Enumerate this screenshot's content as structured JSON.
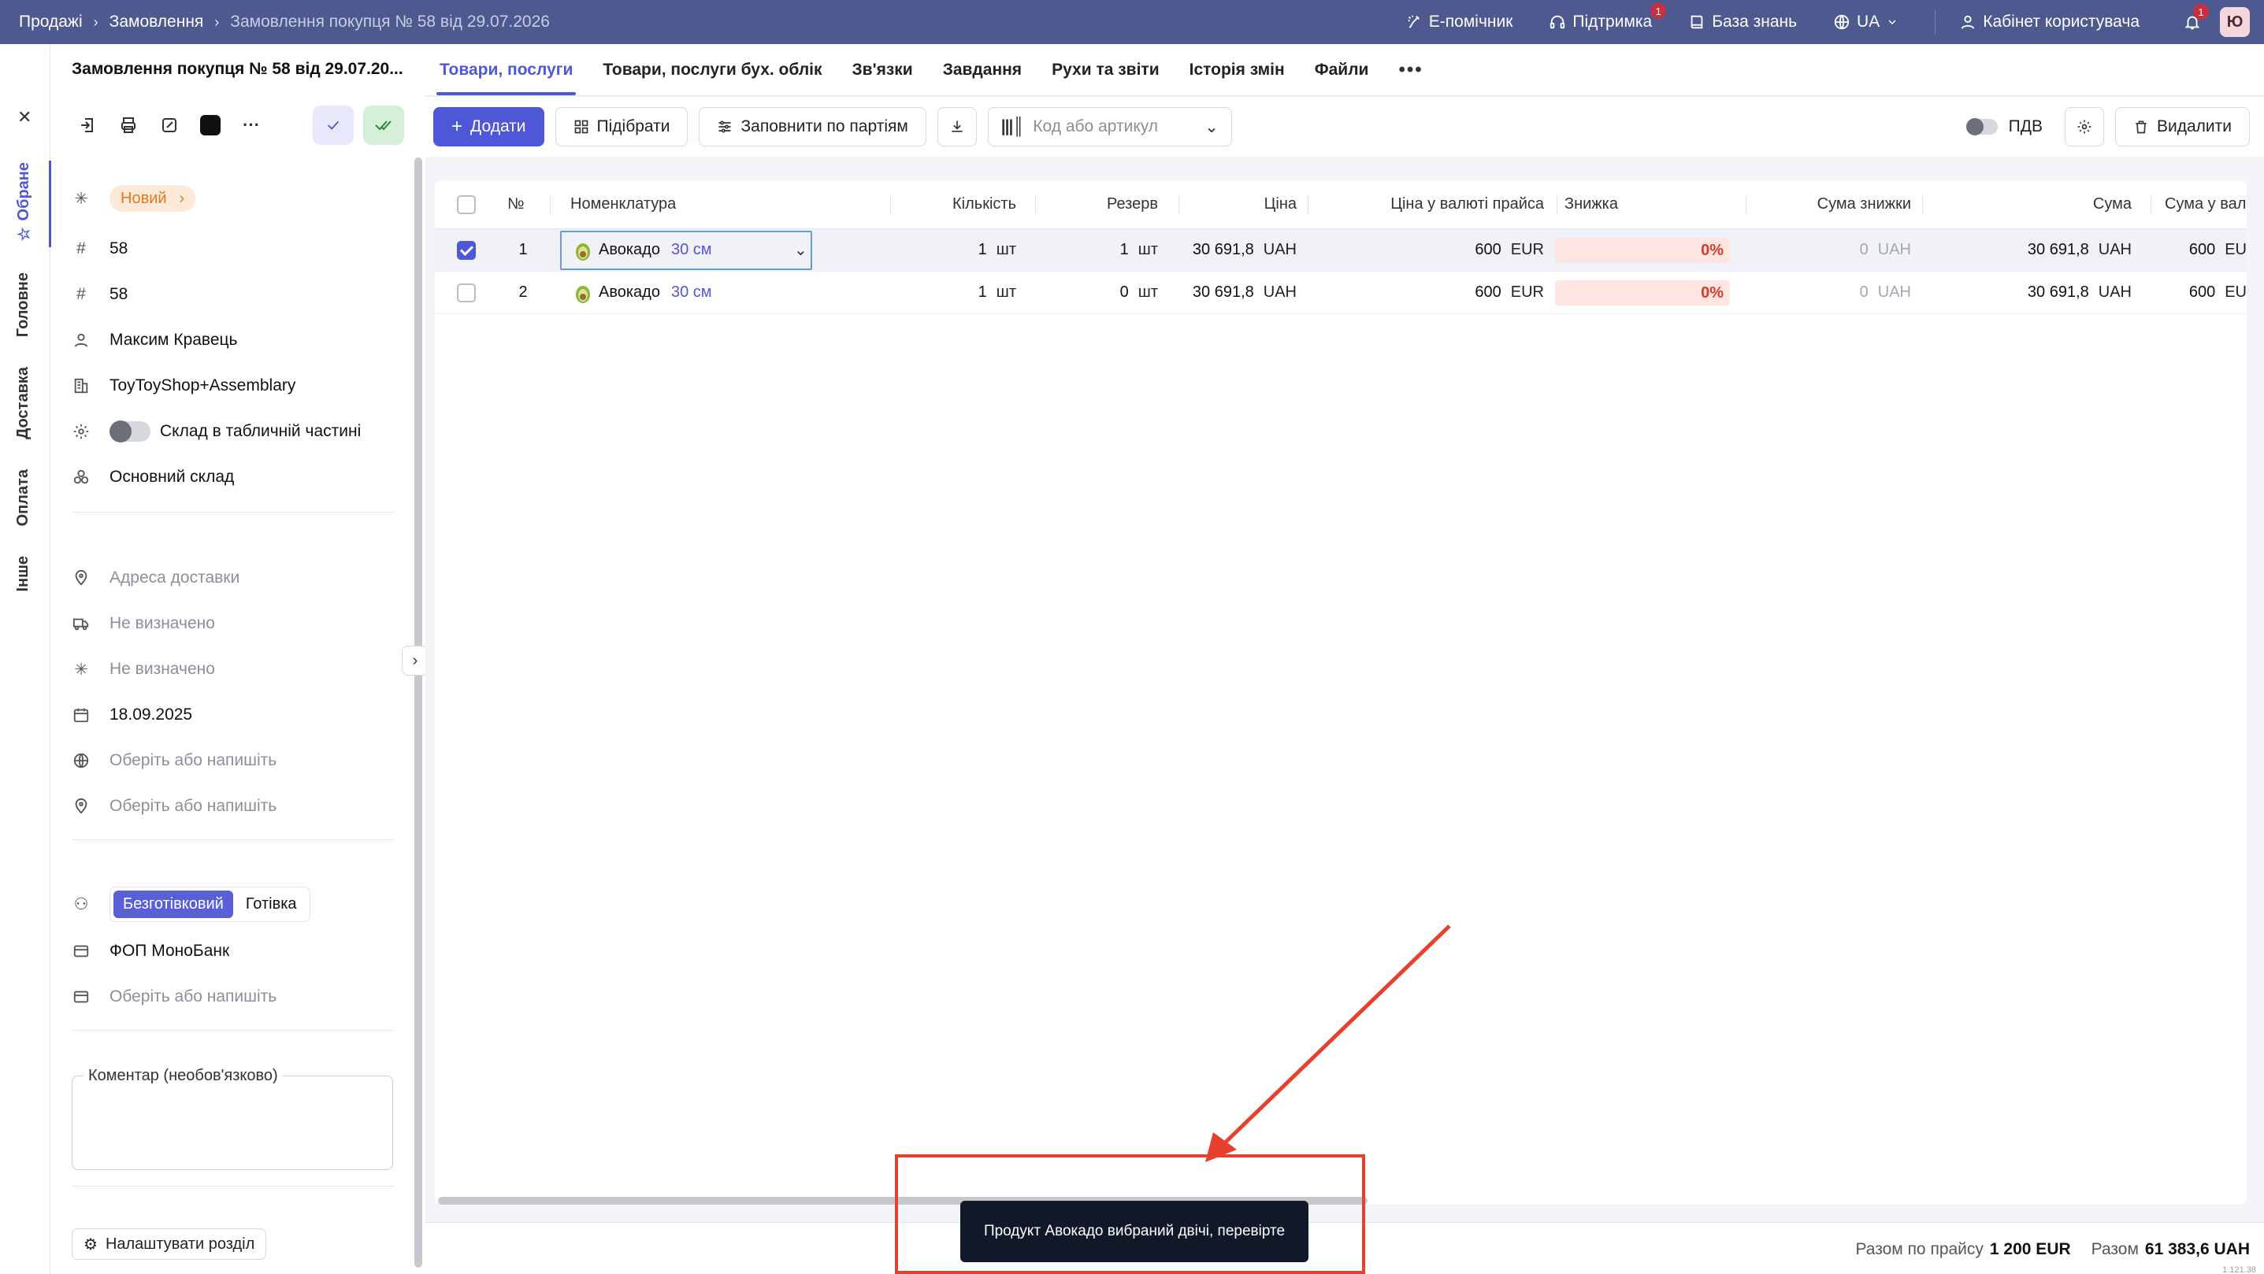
{
  "topbar": {
    "breadcrumbs": [
      "Продажі",
      "Замовлення",
      "Замовлення покупця № 58 від 29.07.2026"
    ],
    "assistant": "E-помічник",
    "support": "Підтримка",
    "support_badge": "1",
    "knowledge": "База знань",
    "language": "UA",
    "cabinet": "Кабінет користувача",
    "notif_badge": "1",
    "avatar": "Ю"
  },
  "vtabs": [
    "Обране",
    "Головне",
    "Доставка",
    "Оплата",
    "Інше"
  ],
  "side": {
    "title": "Замовлення покупця № 58 від 29.07.20...",
    "status": "Новий",
    "number": "58",
    "number2": "58",
    "manager": "Максим Кравець",
    "company": "ToyToyShop+Assemblary",
    "warehouse_toggle_label": "Склад в табличній частині",
    "warehouse": "Основний склад",
    "delivery_address": "Адреса доставки",
    "delivery_method": "Не визначено",
    "delivery_status": "Не визначено",
    "date": "18.09.2025",
    "choose1": "Оберіть або напишіть",
    "choose2": "Оберіть або напишіть",
    "pay_cashless": "Безготівковий",
    "pay_cash": "Готівка",
    "account": "ФОП МоноБанк",
    "choose3": "Оберіть або напишіть",
    "comment_label": "Коментар (необов'язково)",
    "configure": "Налаштувати розділ"
  },
  "tabs": [
    "Товари, послуги",
    "Товари, послуги бух. облік",
    "Зв'язки",
    "Завдання",
    "Рухи та звіти",
    "Історія змін",
    "Файли"
  ],
  "toolbar": {
    "add": "Додати",
    "pick": "Підібрати",
    "fill": "Заповнити по партіям",
    "search_placeholder": "Код або артикул",
    "vat": "ПДВ",
    "delete": "Видалити"
  },
  "table": {
    "headers": [
      "№",
      "Номенклатура",
      "Кількість",
      "Резерв",
      "Ціна",
      "Ціна у валюті прайса",
      "Знижка",
      "Сума знижки",
      "Сума",
      "Сума у валюті прайс"
    ],
    "rows": [
      {
        "n": "1",
        "name": "Авокадо",
        "variant": "30 см",
        "qty": "1",
        "qty_unit": "шт",
        "reserve": "1",
        "reserve_unit": "шт",
        "price": "30 691,8",
        "price_cur": "UAH",
        "price_list": "600",
        "price_list_cur": "EUR",
        "discount": "0%",
        "disc_sum": "0",
        "disc_cur": "UAH",
        "sum": "30 691,8",
        "sum_cur": "UAH",
        "sum_list": "600",
        "sum_list_cur": "EU",
        "selected": true
      },
      {
        "n": "2",
        "name": "Авокадо",
        "variant": "30 см",
        "qty": "1",
        "qty_unit": "шт",
        "reserve": "0",
        "reserve_unit": "шт",
        "price": "30 691,8",
        "price_cur": "UAH",
        "price_list": "600",
        "price_list_cur": "EUR",
        "discount": "0%",
        "disc_sum": "0",
        "disc_cur": "UAH",
        "sum": "30 691,8",
        "sum_cur": "UAH",
        "sum_list": "600",
        "sum_list_cur": "EU",
        "selected": false
      }
    ]
  },
  "footer": {
    "total_list_label": "Разом по прайсу",
    "total_list": "1 200 EUR",
    "total_label": "Разом",
    "total": "61 383,6 UAH",
    "version": "1.121.38"
  },
  "toast": "Продукт Авокадо вибраний двічі, перевірте",
  "colors": {
    "accent": "#4f57d9",
    "topbar": "#4e5a8f",
    "annotation": "#e8402f"
  }
}
